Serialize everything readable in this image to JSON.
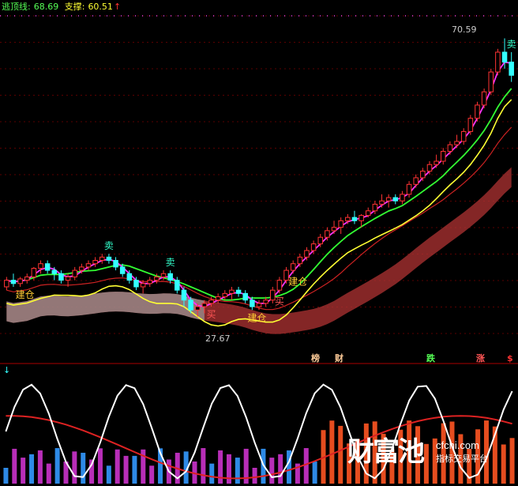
{
  "header": {
    "escape_line_label": "逃顶线:",
    "escape_line_value": "68.69",
    "support_label": "支撑:",
    "support_value": "60.51",
    "up_arrow": "↑",
    "colors": {
      "escape": "#55ff55",
      "support": "#ffff33",
      "arrow": "#ff3333"
    }
  },
  "chart_data": [
    {
      "type": "candlestick",
      "panel": "main",
      "price_range": [
        22,
        74
      ],
      "price_high_label": "70.59",
      "price_low_label": "27.67",
      "candles": [
        [
          33,
          34.5,
          32.5,
          34
        ],
        [
          34,
          35,
          33,
          33.5
        ],
        [
          33.5,
          34.5,
          33,
          34.2
        ],
        [
          34,
          35,
          33.5,
          34.5
        ],
        [
          34.5,
          36,
          34,
          35.8
        ],
        [
          35.8,
          37,
          35,
          36.5
        ],
        [
          36.5,
          37,
          35,
          35.5
        ],
        [
          35.5,
          36,
          34,
          35
        ],
        [
          35,
          35.5,
          33.5,
          34
        ],
        [
          34,
          35,
          33,
          34.5
        ],
        [
          34.5,
          36,
          34,
          35.5
        ],
        [
          35.5,
          36.5,
          35,
          36
        ],
        [
          36,
          37,
          35.5,
          36.5
        ],
        [
          36.5,
          37.5,
          36,
          37
        ],
        [
          37,
          38,
          36.5,
          37.5
        ],
        [
          37.5,
          38,
          36.5,
          37
        ],
        [
          37,
          37.5,
          35.5,
          36
        ],
        [
          36,
          36.5,
          34.5,
          35
        ],
        [
          35,
          35.5,
          33.5,
          34
        ],
        [
          34,
          34.5,
          32.5,
          33
        ],
        [
          33,
          34,
          32,
          33.5
        ],
        [
          33.5,
          34.5,
          33,
          34
        ],
        [
          34,
          35,
          33.5,
          34.5
        ],
        [
          34.5,
          35.5,
          34,
          35
        ],
        [
          35,
          35.5,
          33.5,
          34
        ],
        [
          34,
          34.5,
          32,
          32.5
        ],
        [
          32.5,
          33,
          30,
          31
        ],
        [
          31,
          31.5,
          29,
          29.5
        ],
        [
          29.5,
          30.5,
          28.5,
          30
        ],
        [
          30,
          31,
          29,
          30.5
        ],
        [
          30.5,
          31.5,
          30,
          31
        ],
        [
          31,
          32,
          30.5,
          31.5
        ],
        [
          31.5,
          32.5,
          31,
          32
        ],
        [
          32,
          33,
          31,
          32.5
        ],
        [
          32.5,
          33,
          31.5,
          32
        ],
        [
          32,
          32.5,
          30.5,
          31
        ],
        [
          31,
          31.5,
          29.5,
          30
        ],
        [
          30,
          31,
          29.5,
          30.5
        ],
        [
          30.5,
          31.5,
          30,
          31
        ],
        [
          31,
          33,
          30.5,
          32.5
        ],
        [
          32.5,
          34.5,
          32,
          34
        ],
        [
          34,
          36,
          33.5,
          35.5
        ],
        [
          35.5,
          37,
          35,
          36.5
        ],
        [
          36.5,
          38,
          36,
          37.5
        ],
        [
          37.5,
          39,
          37,
          38.5
        ],
        [
          38.5,
          40,
          38,
          39.5
        ],
        [
          39.5,
          41,
          39,
          40.5
        ],
        [
          40.5,
          42,
          40,
          41.5
        ],
        [
          41.5,
          43,
          41,
          42
        ],
        [
          42,
          43.5,
          41,
          43
        ],
        [
          43,
          44,
          42.5,
          43.5
        ],
        [
          43.5,
          44.5,
          42.5,
          43
        ],
        [
          43,
          44,
          42,
          43.8
        ],
        [
          43.8,
          45,
          43.5,
          44.5
        ],
        [
          44.5,
          46,
          44,
          45.5
        ],
        [
          45.5,
          47,
          45,
          46
        ],
        [
          46,
          47,
          45,
          46.5
        ],
        [
          46.5,
          47,
          45.5,
          46
        ],
        [
          46,
          47.5,
          45.5,
          47
        ],
        [
          47,
          49,
          46.5,
          48.5
        ],
        [
          48.5,
          50,
          48,
          49.5
        ],
        [
          49.5,
          51,
          49,
          50.5
        ],
        [
          50.5,
          52,
          50,
          51.5
        ],
        [
          51.5,
          53,
          51,
          52
        ],
        [
          52,
          54,
          51.5,
          53.5
        ],
        [
          53.5,
          55,
          53,
          54.5
        ],
        [
          54.5,
          56,
          54,
          55
        ],
        [
          55,
          57,
          54.5,
          56.5
        ],
        [
          56.5,
          59,
          56,
          58.5
        ],
        [
          58.5,
          61,
          58,
          60.5
        ],
        [
          60.5,
          63,
          60,
          62.5
        ],
        [
          62.5,
          66,
          62,
          65.5
        ],
        [
          65.5,
          69,
          65,
          68.5
        ],
        [
          68.5,
          70.59,
          66,
          67
        ],
        [
          67,
          68.5,
          64,
          65
        ]
      ],
      "overlay_series": [
        {
          "color": "#ff33ff",
          "role": "short average"
        },
        {
          "color": "#33ff33",
          "role": "medium average"
        },
        {
          "color": "#ffff33",
          "role": "support"
        },
        {
          "color": "#cc2222",
          "role": "long average"
        },
        {
          "color": "#b03333",
          "role": "trend ribbon"
        },
        {
          "color": "#9a9a9a",
          "role": "trend ribbon (early)"
        }
      ],
      "signals": [
        {
          "text": "建仓",
          "color": "#ffcc33"
        },
        {
          "text": "建仓",
          "color": "#ffcc33"
        },
        {
          "text": "卖",
          "color": "#33ffcc"
        },
        {
          "text": "卖",
          "color": "#33ffcc"
        },
        {
          "text": "卖",
          "color": "#33ffcc"
        },
        {
          "text": "买",
          "color": "#ff5555"
        },
        {
          "text": "买",
          "color": "#ff5555"
        },
        {
          "text": "建仓",
          "color": "#ffcc33"
        }
      ],
      "tags": [
        {
          "text": "榜",
          "color": "#ffcc99"
        },
        {
          "text": "财",
          "color": "#ffcc99"
        },
        {
          "text": "跌",
          "color": "#55ff55"
        },
        {
          "text": "涨",
          "color": "#ff5555"
        },
        {
          "text": "$",
          "color": "#ff3333"
        }
      ]
    },
    {
      "type": "bar",
      "panel": "sub",
      "series": [
        {
          "color": "#ff5522",
          "role": "red bars"
        },
        {
          "color": "#3399ff",
          "role": "blue bars"
        },
        {
          "color": "#cc33cc",
          "role": "purple bars"
        },
        {
          "color": "#ffffff",
          "role": "white line"
        },
        {
          "color": "#dd2222",
          "role": "red line"
        }
      ]
    }
  ],
  "watermark": {
    "brand": "财富池",
    "url": "cfchi.com",
    "tagline": "指标交易平台"
  }
}
